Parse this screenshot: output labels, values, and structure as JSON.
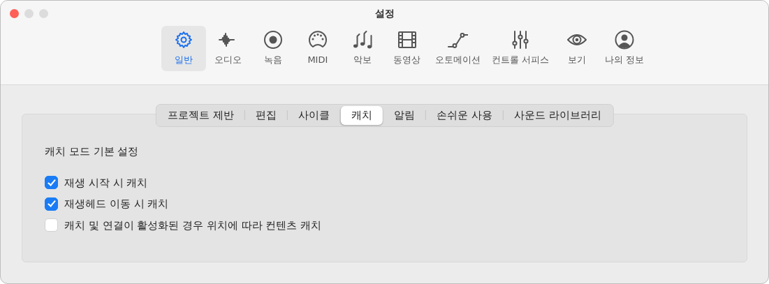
{
  "window": {
    "title": "설정"
  },
  "toolbar": [
    {
      "label": "일반",
      "selected": true
    },
    {
      "label": "오디오",
      "selected": false
    },
    {
      "label": "녹음",
      "selected": false
    },
    {
      "label": "MIDI",
      "selected": false
    },
    {
      "label": "악보",
      "selected": false
    },
    {
      "label": "동영상",
      "selected": false
    },
    {
      "label": "오토메이션",
      "selected": false
    },
    {
      "label": "컨트롤 서피스",
      "selected": false
    },
    {
      "label": "보기",
      "selected": false
    },
    {
      "label": "나의 정보",
      "selected": false
    }
  ],
  "tabs": [
    {
      "label": "프로젝트 제반",
      "selected": false
    },
    {
      "label": "편집",
      "selected": false
    },
    {
      "label": "사이클",
      "selected": false
    },
    {
      "label": "캐치",
      "selected": true
    },
    {
      "label": "알림",
      "selected": false
    },
    {
      "label": "손쉬운 사용",
      "selected": false
    },
    {
      "label": "사운드 라이브러리",
      "selected": false
    }
  ],
  "section": {
    "heading": "캐치 모드 기본 설정",
    "options": [
      {
        "label": "재생 시작 시 캐치",
        "checked": true
      },
      {
        "label": "재생헤드 이동 시 캐치",
        "checked": true
      },
      {
        "label": "캐치 및 연결이 활성화된 경우 위치에 따라 컨텐츠 캐치",
        "checked": false
      }
    ]
  }
}
